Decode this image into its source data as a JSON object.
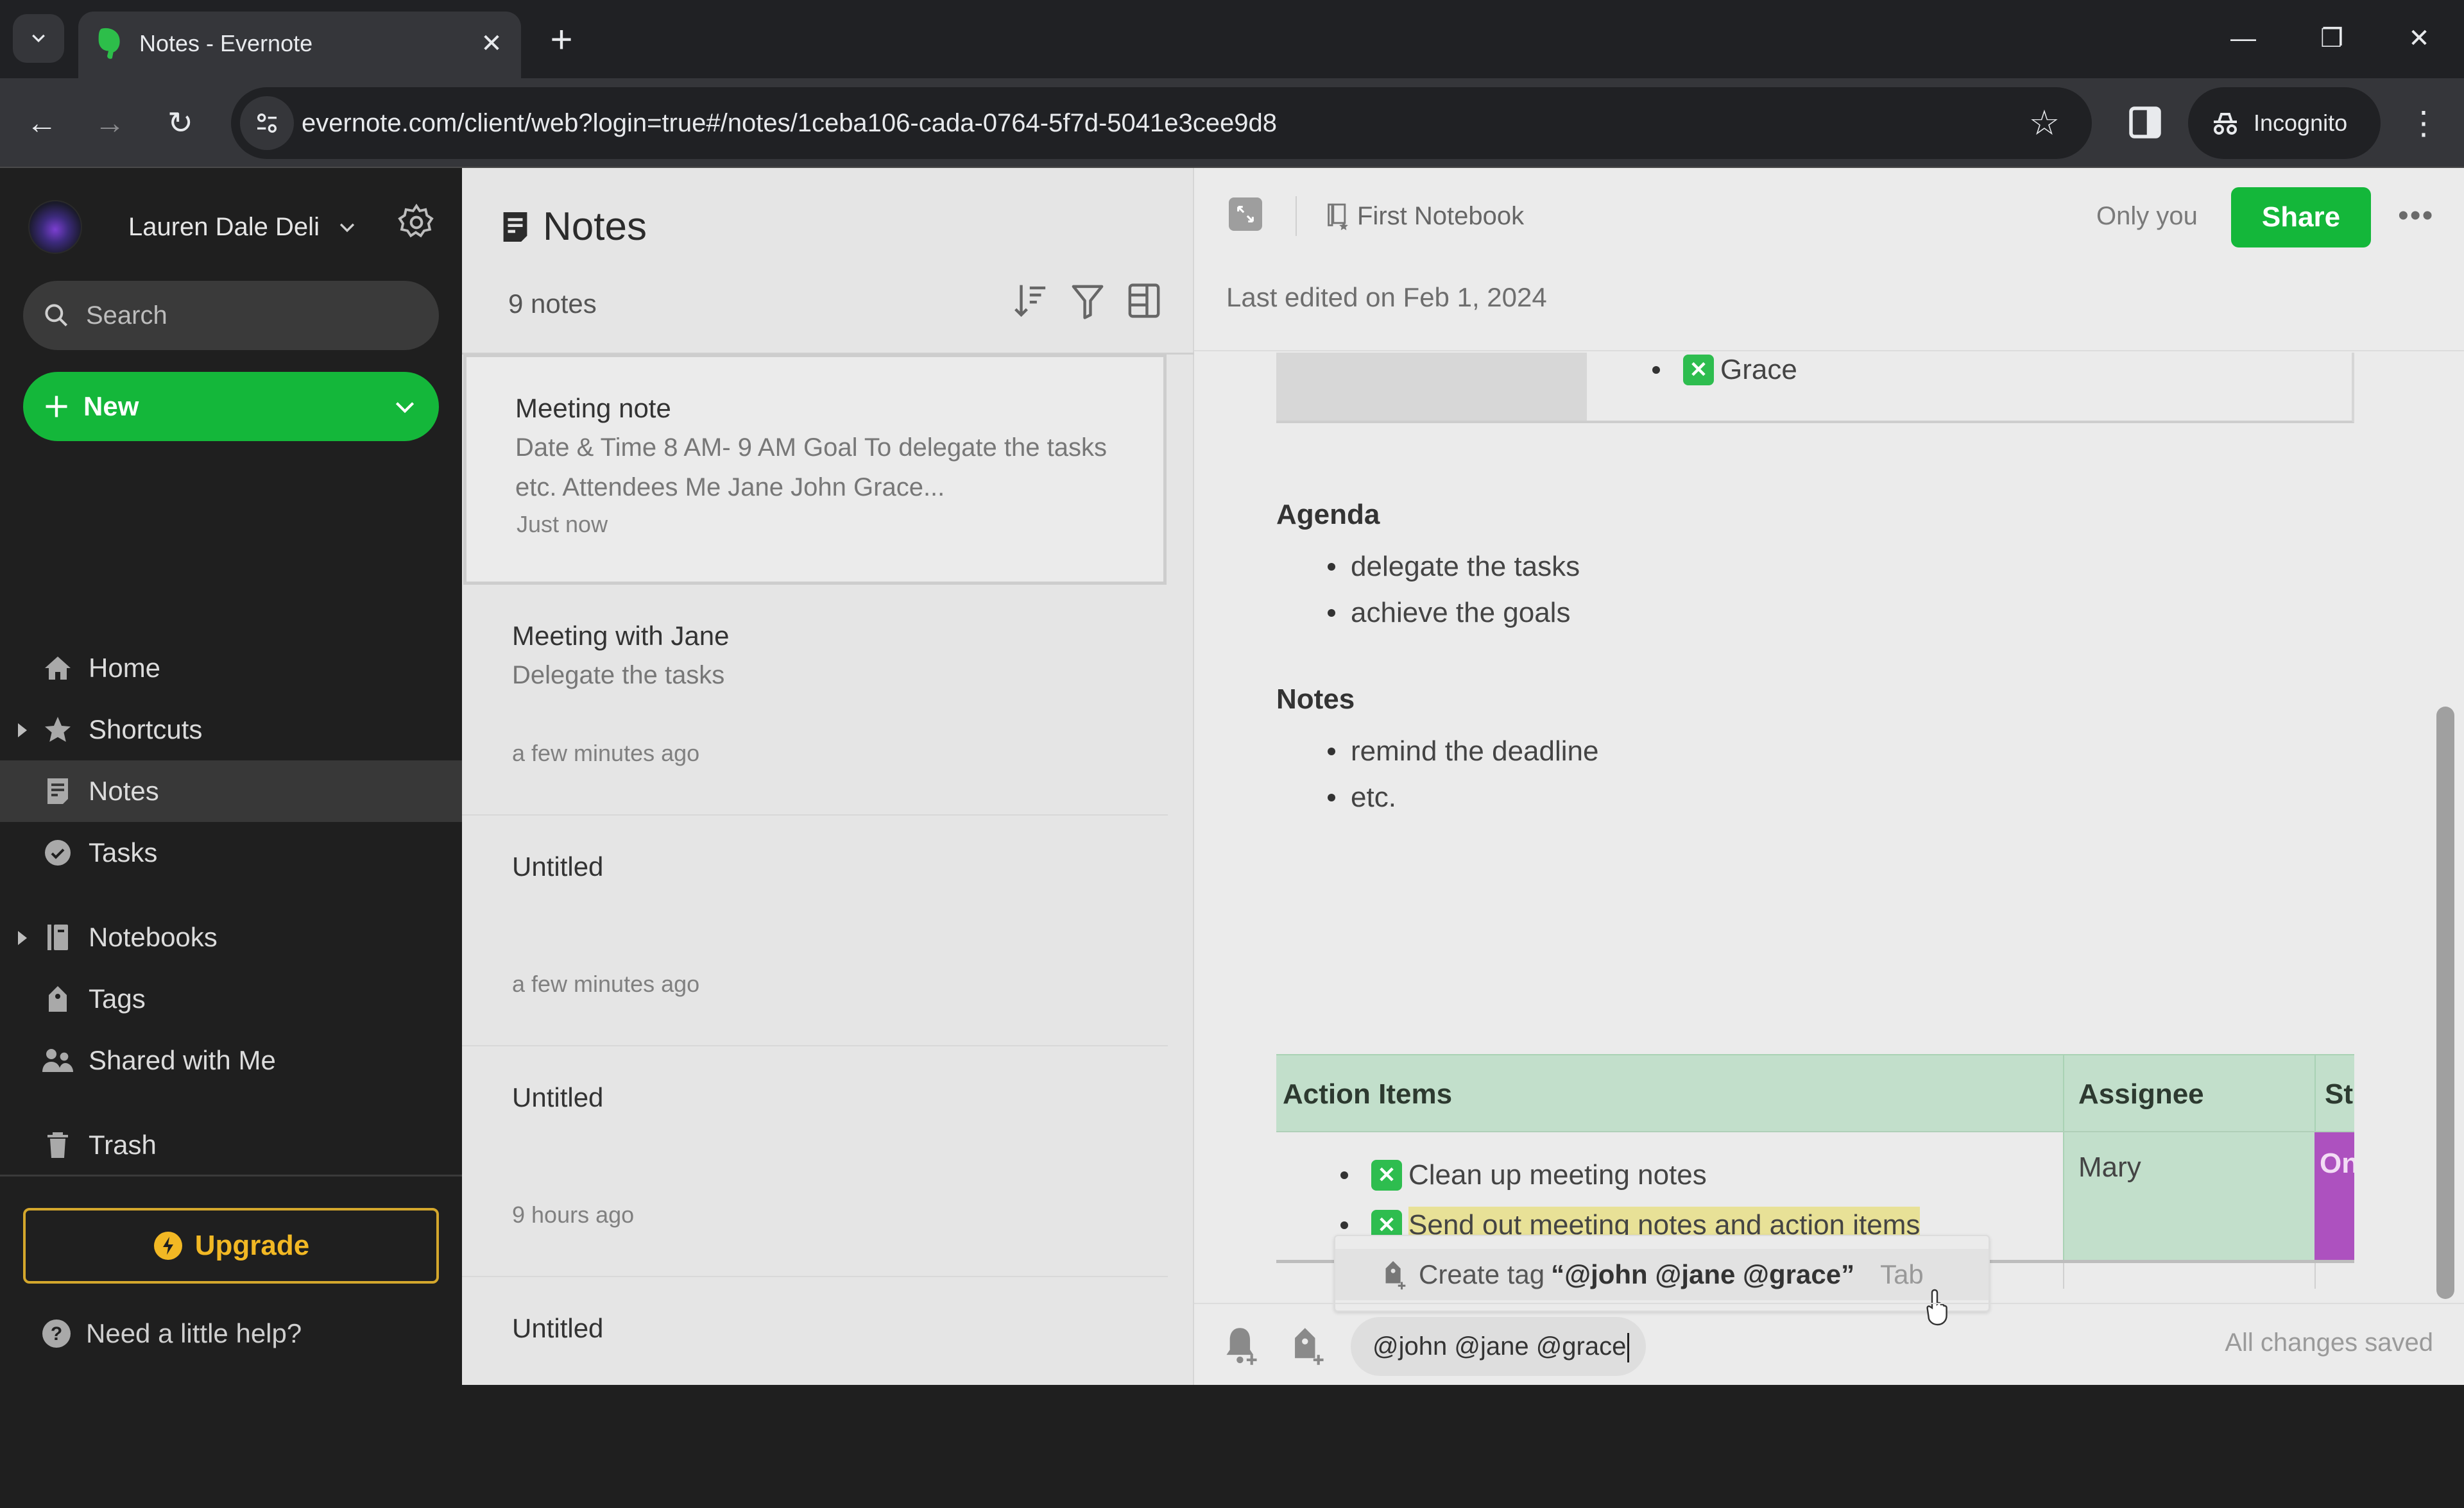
{
  "browser": {
    "tab_title": "Notes - Evernote",
    "url": "evernote.com/client/web?login=true#/notes/1ceba106-cada-0764-5f7d-5041e3cee9d8",
    "incognito_label": "Incognito"
  },
  "sidebar": {
    "account_name": "Lauren Dale Deli",
    "search_placeholder": "Search",
    "new_label": "New",
    "items": [
      {
        "label": "Home",
        "icon": "home-icon"
      },
      {
        "label": "Shortcuts",
        "icon": "star-icon",
        "expandable": true
      },
      {
        "label": "Notes",
        "icon": "note-icon",
        "active": true
      },
      {
        "label": "Tasks",
        "icon": "check-circle-icon"
      },
      {
        "label": "Notebooks",
        "icon": "notebook-icon",
        "expandable": true
      },
      {
        "label": "Tags",
        "icon": "tag-icon"
      },
      {
        "label": "Shared with Me",
        "icon": "people-icon"
      },
      {
        "label": "Trash",
        "icon": "trash-icon"
      }
    ],
    "upgrade_label": "Upgrade",
    "help_label": "Need a little help?"
  },
  "notelist": {
    "title": "Notes",
    "count": "9 notes",
    "notes": [
      {
        "title": "Meeting note",
        "snippet": "Date & Time 8 AM- 9 AM Goal To delegate the tasks etc. Attendees Me Jane John Grace...",
        "time": "Just now",
        "selected": true
      },
      {
        "title": "Meeting with Jane",
        "snippet": "Delegate the tasks",
        "time": "a few minutes ago"
      },
      {
        "title": "Untitled",
        "snippet": "",
        "time": "a few minutes ago"
      },
      {
        "title": "Untitled",
        "snippet": "",
        "time": "9 hours ago"
      },
      {
        "title": "Untitled",
        "snippet": "",
        "time": ""
      }
    ]
  },
  "editor": {
    "notebook": "First Notebook",
    "visibility": "Only you",
    "share_label": "Share",
    "last_edited": "Last edited on Feb 1, 2024",
    "attendee_item": "Grace",
    "agenda": {
      "heading": "Agenda",
      "items": [
        "delegate the tasks",
        "achieve the goals"
      ]
    },
    "notes_section": {
      "heading": "Notes",
      "items": [
        "remind the deadline",
        "etc."
      ]
    },
    "action_table": {
      "headers": [
        "Action Items",
        "Assignee",
        "St"
      ],
      "rows": [
        {
          "items": [
            "Clean up meeting notes",
            "Send out meeting notes and action items"
          ],
          "assignee": "Mary",
          "status": "On"
        }
      ]
    },
    "tag_popup": {
      "label": "Create tag",
      "value": "“@john @jane @grace”",
      "hint": "Tab"
    },
    "tag_input_value": "@john @jane @grace",
    "save_status": "All changes saved"
  },
  "colors": {
    "brand_green": "#14b73a",
    "upgrade_gold": "#f2b824",
    "table_header_green": "#c2dfcb",
    "status_purple": "#ad51bf",
    "highlight_yellow": "#e8e197"
  }
}
